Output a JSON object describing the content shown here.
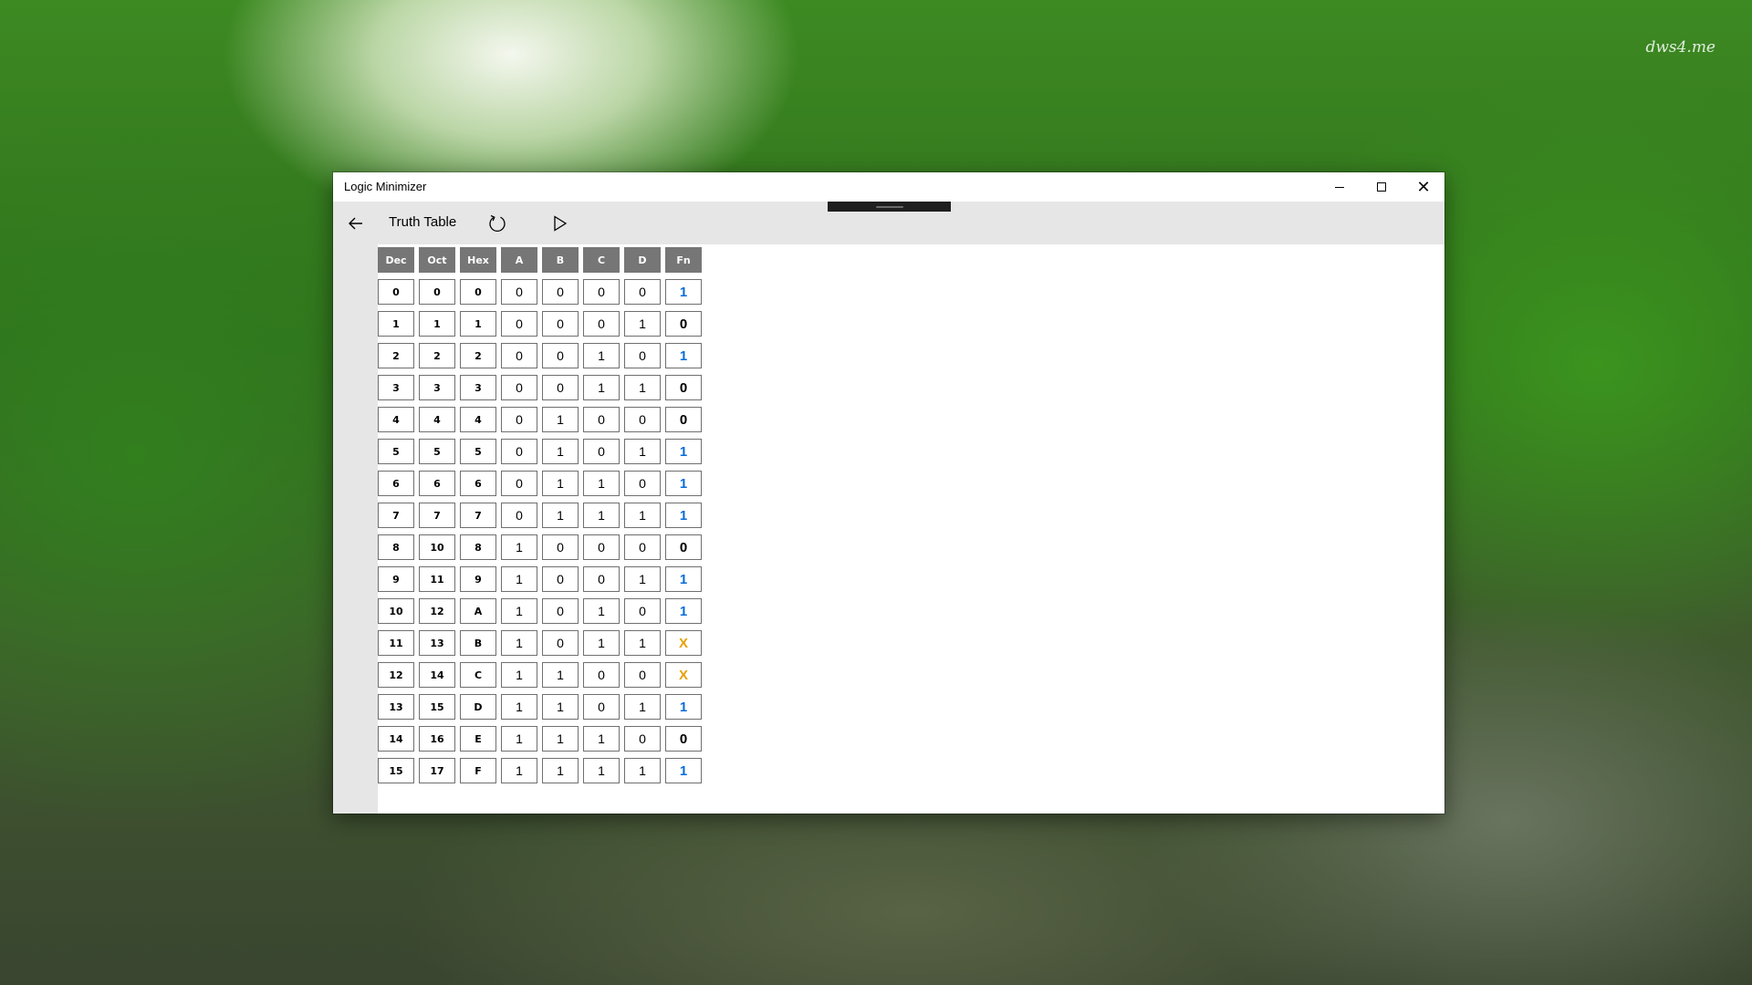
{
  "desktop": {
    "watermark": "dws4.me"
  },
  "window": {
    "title": "Logic Minimizer",
    "controls": {
      "minimize": "minimize-icon",
      "maximize": "maximize-icon",
      "close": "close-icon"
    }
  },
  "toolbar": {
    "back_icon": "back-arrow-icon",
    "title": "Truth Table",
    "reset_icon": "refresh-icon",
    "run_icon": "play-icon"
  },
  "table": {
    "headers": [
      "Dec",
      "Oct",
      "Hex",
      "A",
      "B",
      "C",
      "D",
      "Fn"
    ],
    "rows": [
      {
        "dec": "0",
        "oct": "0",
        "hex": "0",
        "a": "0",
        "b": "0",
        "c": "0",
        "d": "0",
        "fn": "1"
      },
      {
        "dec": "1",
        "oct": "1",
        "hex": "1",
        "a": "0",
        "b": "0",
        "c": "0",
        "d": "1",
        "fn": "0"
      },
      {
        "dec": "2",
        "oct": "2",
        "hex": "2",
        "a": "0",
        "b": "0",
        "c": "1",
        "d": "0",
        "fn": "1"
      },
      {
        "dec": "3",
        "oct": "3",
        "hex": "3",
        "a": "0",
        "b": "0",
        "c": "1",
        "d": "1",
        "fn": "0"
      },
      {
        "dec": "4",
        "oct": "4",
        "hex": "4",
        "a": "0",
        "b": "1",
        "c": "0",
        "d": "0",
        "fn": "0"
      },
      {
        "dec": "5",
        "oct": "5",
        "hex": "5",
        "a": "0",
        "b": "1",
        "c": "0",
        "d": "1",
        "fn": "1"
      },
      {
        "dec": "6",
        "oct": "6",
        "hex": "6",
        "a": "0",
        "b": "1",
        "c": "1",
        "d": "0",
        "fn": "1"
      },
      {
        "dec": "7",
        "oct": "7",
        "hex": "7",
        "a": "0",
        "b": "1",
        "c": "1",
        "d": "1",
        "fn": "1"
      },
      {
        "dec": "8",
        "oct": "10",
        "hex": "8",
        "a": "1",
        "b": "0",
        "c": "0",
        "d": "0",
        "fn": "0"
      },
      {
        "dec": "9",
        "oct": "11",
        "hex": "9",
        "a": "1",
        "b": "0",
        "c": "0",
        "d": "1",
        "fn": "1"
      },
      {
        "dec": "10",
        "oct": "12",
        "hex": "A",
        "a": "1",
        "b": "0",
        "c": "1",
        "d": "0",
        "fn": "1"
      },
      {
        "dec": "11",
        "oct": "13",
        "hex": "B",
        "a": "1",
        "b": "0",
        "c": "1",
        "d": "1",
        "fn": "X"
      },
      {
        "dec": "12",
        "oct": "14",
        "hex": "C",
        "a": "1",
        "b": "1",
        "c": "0",
        "d": "0",
        "fn": "X"
      },
      {
        "dec": "13",
        "oct": "15",
        "hex": "D",
        "a": "1",
        "b": "1",
        "c": "0",
        "d": "1",
        "fn": "1"
      },
      {
        "dec": "14",
        "oct": "16",
        "hex": "E",
        "a": "1",
        "b": "1",
        "c": "1",
        "d": "0",
        "fn": "0"
      },
      {
        "dec": "15",
        "oct": "17",
        "hex": "F",
        "a": "1",
        "b": "1",
        "c": "1",
        "d": "1",
        "fn": "1"
      }
    ]
  },
  "colors": {
    "fn_one": "#0a6cd8",
    "fn_zero": "#000000",
    "fn_dont_care": "#e8a000",
    "header_bg": "#767676"
  }
}
